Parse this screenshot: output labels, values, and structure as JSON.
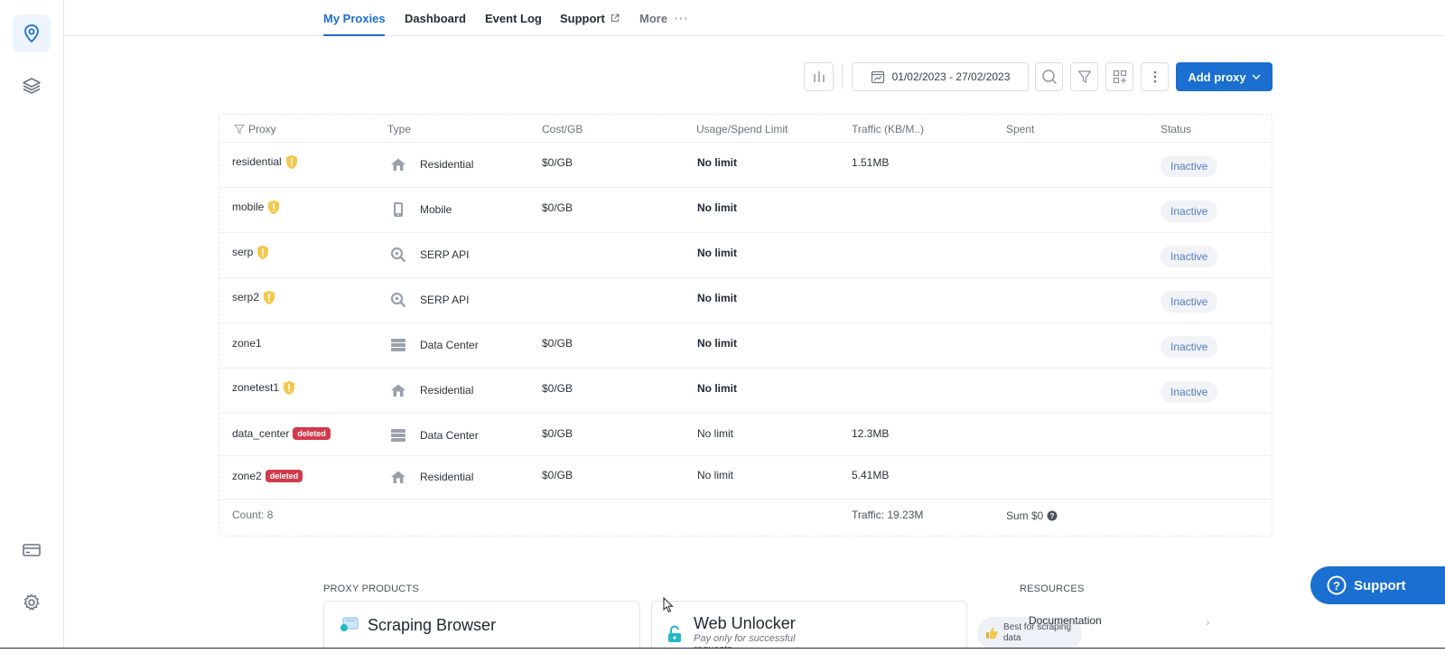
{
  "nav": {
    "tabs": [
      {
        "label": "My Proxies",
        "active": true
      },
      {
        "label": "Dashboard"
      },
      {
        "label": "Event Log"
      },
      {
        "label": "Support"
      },
      {
        "label": "More"
      }
    ]
  },
  "toolbar": {
    "date_range": "01/02/2023 - 27/02/2023",
    "add_proxy_label": "Add proxy"
  },
  "table": {
    "headers": [
      "Proxy",
      "Type",
      "Cost/GB",
      "Usage/Spend Limit",
      "Traffic (KB/M..)",
      "Spent",
      "Status"
    ],
    "rows": [
      {
        "name": "residential",
        "warning": true,
        "deleted": false,
        "type": "Residential",
        "type_icon": "house-icon",
        "cost": "$0/GB",
        "limit": "No limit",
        "limit_bold": true,
        "traffic": "1.51MB",
        "spent": "",
        "status": "Inactive"
      },
      {
        "name": "mobile",
        "warning": true,
        "deleted": false,
        "type": "Mobile",
        "type_icon": "mobile-icon",
        "cost": "$0/GB",
        "limit": "No limit",
        "limit_bold": true,
        "traffic": "",
        "spent": "",
        "status": "Inactive"
      },
      {
        "name": "serp",
        "warning": true,
        "deleted": false,
        "type": "SERP API",
        "type_icon": "search-zoom-icon",
        "cost": "",
        "limit": "No limit",
        "limit_bold": true,
        "traffic": "",
        "spent": "",
        "status": "Inactive"
      },
      {
        "name": "serp2",
        "warning": true,
        "deleted": false,
        "type": "SERP API",
        "type_icon": "search-zoom-icon",
        "cost": "",
        "limit": "No limit",
        "limit_bold": true,
        "traffic": "",
        "spent": "",
        "status": "Inactive"
      },
      {
        "name": "zone1",
        "warning": false,
        "deleted": false,
        "type": "Data Center",
        "type_icon": "server-icon",
        "cost": "$0/GB",
        "limit": "No limit",
        "limit_bold": true,
        "traffic": "",
        "spent": "",
        "status": "Inactive"
      },
      {
        "name": "zonetest1",
        "warning": true,
        "deleted": false,
        "type": "Residential",
        "type_icon": "house-icon",
        "cost": "$0/GB",
        "limit": "No limit",
        "limit_bold": true,
        "traffic": "",
        "spent": "",
        "status": "Inactive"
      },
      {
        "name": "data_center",
        "warning": false,
        "deleted": true,
        "type": "Data Center",
        "type_icon": "server-icon",
        "cost": "$0/GB",
        "limit": "No limit",
        "limit_bold": false,
        "traffic": "12.3MB",
        "spent": "",
        "status": ""
      },
      {
        "name": "zone2",
        "warning": false,
        "deleted": true,
        "type": "Residential",
        "type_icon": "house-icon",
        "cost": "$0/GB",
        "limit": "No limit",
        "limit_bold": false,
        "traffic": "5.41MB",
        "spent": "",
        "status": ""
      }
    ],
    "deleted_label": "deleted",
    "footer": {
      "count": "Count: 8",
      "traffic": "Traffic: 19.23M",
      "sum": "Sum $0"
    }
  },
  "products": {
    "section_label": "PROXY PRODUCTS",
    "cards": [
      {
        "title": "Scraping Browser",
        "icon": "browser-icon"
      },
      {
        "title": "Web Unlocker",
        "subtitle": "Pay only for successful requests",
        "icon": "unlock-icon",
        "badge": "Best for scraping data"
      }
    ]
  },
  "resources": {
    "section_label": "RESOURCES",
    "links": [
      "Documentation"
    ]
  },
  "support_button": "Support",
  "colors": {
    "accent": "#1a6fd1",
    "deleted": "#d23a4a",
    "warning": "#f2c94c",
    "status_text": "#4f7dc4"
  }
}
